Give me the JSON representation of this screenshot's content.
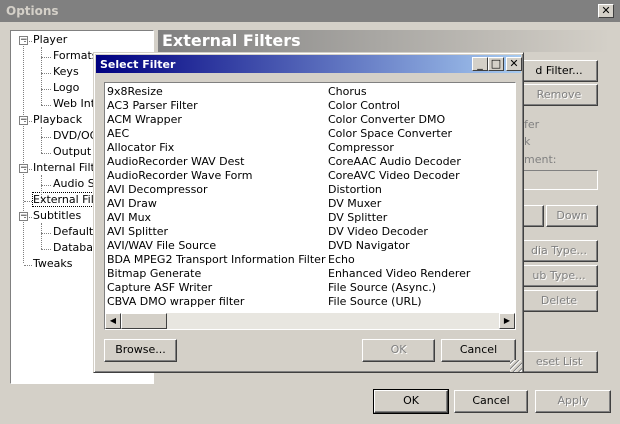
{
  "window": {
    "title": "Options"
  },
  "close_glyph": "✕",
  "tree": [
    {
      "label": "Player",
      "expander": "−"
    },
    {
      "label": "Formats"
    },
    {
      "label": "Keys"
    },
    {
      "label": "Logo"
    },
    {
      "label": "Web Int"
    },
    {
      "label": "Playback",
      "expander": "−"
    },
    {
      "label": "DVD/OG"
    },
    {
      "label": "Output"
    },
    {
      "label": "Internal Filte",
      "expander": "−"
    },
    {
      "label": "Audio Sw"
    },
    {
      "label": "External Filte"
    },
    {
      "label": "Subtitles",
      "expander": "−"
    },
    {
      "label": "Default"
    },
    {
      "label": "Databas"
    },
    {
      "label": "Tweaks"
    }
  ],
  "panel": {
    "title": "External Filters",
    "add_filter": "d Filter...",
    "remove": "Remove",
    "label_1": "fer",
    "label_2": "k",
    "label_3": "ment:",
    "up": "",
    "down": "Down",
    "add_media_type": "dia Type...",
    "add_sub_type": "ub Type...",
    "delete": "Delete",
    "reset_list": "eset List"
  },
  "footer": {
    "ok": "OK",
    "cancel": "Cancel",
    "apply": "Apply"
  },
  "dialog": {
    "title": "Select Filter",
    "minimize_glyph": "_",
    "maximize_glyph": "□",
    "close_glyph": "✕",
    "filters_col1": [
      "9x8Resize",
      "AC3 Parser Filter",
      "ACM Wrapper",
      "AEC",
      "Allocator Fix",
      "AudioRecorder WAV Dest",
      "AudioRecorder Wave Form",
      "AVI Decompressor",
      "AVI Draw",
      "AVI Mux",
      "AVI Splitter",
      "AVI/WAV File Source",
      "BDA MPEG2 Transport Information Filter",
      "Bitmap Generate",
      "Capture ASF Writer",
      "CBVA DMO wrapper filter"
    ],
    "filters_col2": [
      "Chorus",
      "Color Control",
      "Color Converter DMO",
      "Color Space Converter",
      "Compressor",
      "CoreAAC Audio Decoder",
      "CoreAVC Video Decoder",
      "Distortion",
      "DV Muxer",
      "DV Splitter",
      "DV Video Decoder",
      "DVD Navigator",
      "Echo",
      "Enhanced Video Renderer",
      "File Source (Async.)",
      "File Source (URL)"
    ],
    "scroll_left_glyph": "◀",
    "scroll_right_glyph": "▶",
    "scroll_position": 0,
    "browse": "Browse...",
    "ok": "OK",
    "cancel": "Cancel"
  }
}
